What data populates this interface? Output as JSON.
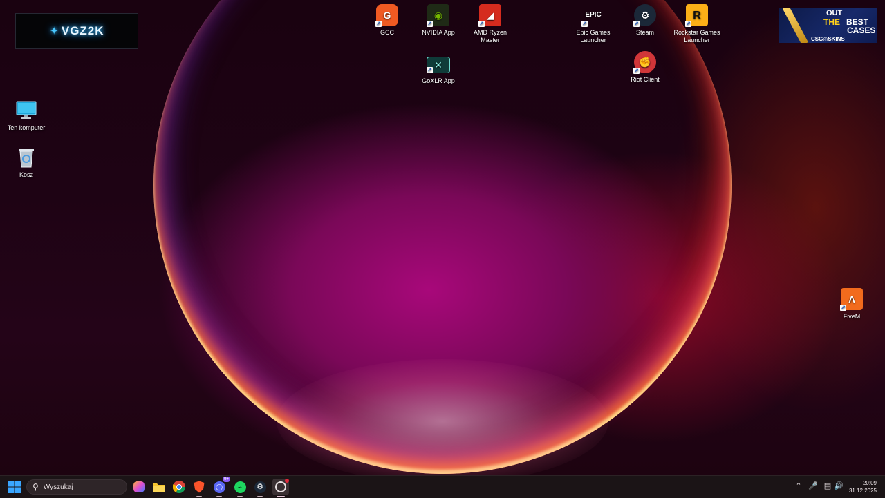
{
  "desktop": {
    "top_icons": [
      {
        "label": "GCC",
        "icon": "gcc-icon",
        "color": "#f05a22"
      },
      {
        "label": "NVIDIA App",
        "icon": "nvidia-icon",
        "color": "#76b900"
      },
      {
        "label": "AMD Ryzen Master",
        "icon": "amd-ryzen-master-icon",
        "color": "#d52b1e"
      },
      {
        "label": "Epic Games Launcher",
        "icon": "epic-games-icon",
        "color": "#111111"
      },
      {
        "label": "Steam",
        "icon": "steam-icon",
        "color": "#1b2838"
      },
      {
        "label": "Rockstar Games Launcher",
        "icon": "rockstar-icon",
        "color": "#fcaf17"
      },
      {
        "label": "GoXLR App",
        "icon": "goxlr-icon",
        "color": "#0f3b39"
      },
      {
        "label": "Riot Client",
        "icon": "riot-client-icon",
        "color": "#d13639"
      }
    ],
    "left_icons": [
      {
        "label": "Ten komputer",
        "icon": "monitor-icon"
      },
      {
        "label": "Kosz",
        "icon": "recycle-bin-icon"
      }
    ],
    "right_icons": [
      {
        "label": "FiveM",
        "icon": "fivem-icon",
        "color": "#f26b1d"
      }
    ],
    "logo_widget": {
      "text": "VGZ2K"
    },
    "ad_banner": {
      "line1": "OUT",
      "line2": "THE",
      "line3": "BEST",
      "line4": "CASES",
      "brand": "CSG◎SKINS"
    }
  },
  "taskbar": {
    "search_placeholder": "Wyszukaj",
    "pinned": [
      {
        "name": "copilot",
        "icon": "copilot-icon"
      },
      {
        "name": "file-explorer",
        "icon": "folder-icon"
      },
      {
        "name": "chrome",
        "icon": "chrome-icon"
      },
      {
        "name": "brave",
        "icon": "brave-icon"
      },
      {
        "name": "discord",
        "icon": "discord-icon",
        "badge": "9+"
      },
      {
        "name": "spotify",
        "icon": "spotify-icon"
      },
      {
        "name": "steam",
        "icon": "steam-icon"
      },
      {
        "name": "obs",
        "icon": "obs-icon"
      }
    ],
    "clock": {
      "time": "20:09",
      "date": "31.12.2025"
    }
  }
}
